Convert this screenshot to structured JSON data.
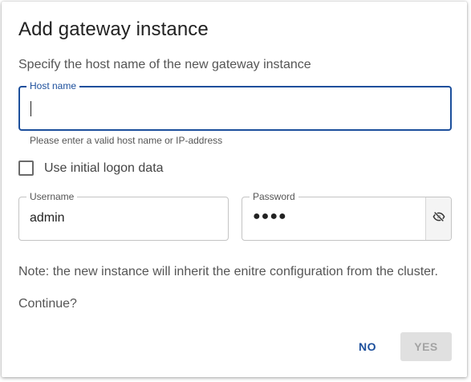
{
  "dialog": {
    "title": "Add gateway instance",
    "description": "Specify the host name of the new gateway instance",
    "host_name": {
      "label": "Host name",
      "value": "",
      "helper": "Please enter a valid host name or IP-address"
    },
    "use_initial_logon": {
      "label": "Use initial logon data",
      "checked": false
    },
    "username": {
      "label": "Username",
      "value": "admin"
    },
    "password": {
      "label": "Password",
      "masked_value": "●●●●",
      "toggle_icon": "eye-off-icon"
    },
    "note": "Note: the new instance will inherit the enitre configuration from the cluster.",
    "question": "Continue?",
    "buttons": {
      "no": "NO",
      "yes": "YES"
    }
  },
  "colors": {
    "primary": "#1c4f9c",
    "disabled_bg": "#e0e0e0",
    "disabled_text": "#a3a3a3"
  }
}
